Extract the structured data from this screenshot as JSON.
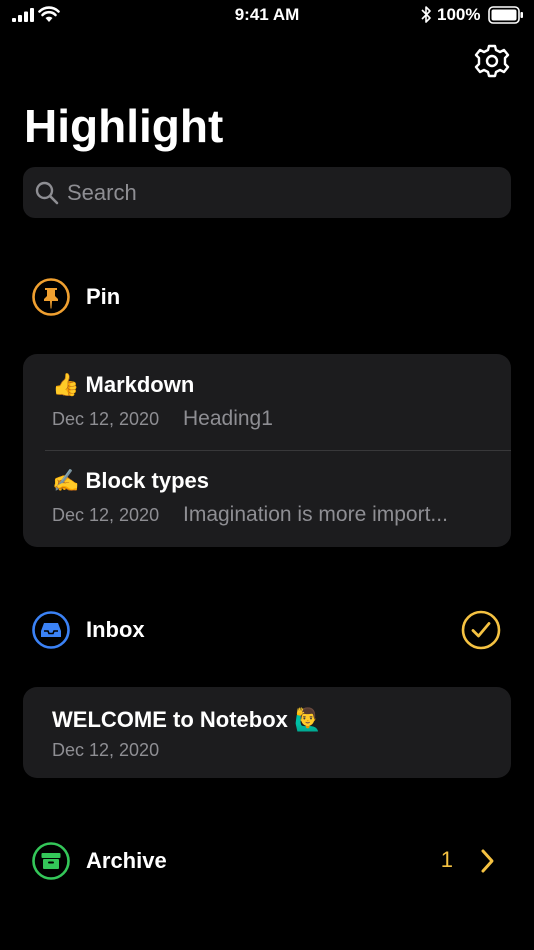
{
  "status_bar": {
    "time": "9:41 AM",
    "battery_percent": "100%",
    "icons": [
      "signal-icon",
      "wifi-icon",
      "bluetooth-icon",
      "battery-icon"
    ]
  },
  "header": {
    "title": "Highlight",
    "settings_icon": "gear-icon"
  },
  "search": {
    "placeholder": "Search",
    "value": ""
  },
  "sections": {
    "pin": {
      "label": "Pin",
      "icon": "pin-icon",
      "color": "#f0a030",
      "notes": [
        {
          "title": "👍 Markdown",
          "date": "Dec 12, 2020",
          "preview": "Heading1"
        },
        {
          "title": "✍️ Block types",
          "date": "Dec 12, 2020",
          "preview": "Imagination is more import..."
        }
      ]
    },
    "inbox": {
      "label": "Inbox",
      "icon": "inbox-tray-icon",
      "color": "#3b82f6",
      "action_icon": "checkmark-circle-icon",
      "action_color": "#f5c242",
      "notes": [
        {
          "title": "WELCOME to Notebox 🙋‍♂️",
          "date": "Dec 12, 2020"
        }
      ]
    },
    "archive": {
      "label": "Archive",
      "icon": "archive-box-icon",
      "color": "#34c759",
      "count": "1",
      "chevron_icon": "chevron-right-icon"
    }
  },
  "colors": {
    "background": "#000000",
    "card": "#1c1c1e",
    "secondary_text": "#8e8e93",
    "accent_yellow": "#f5c242"
  }
}
